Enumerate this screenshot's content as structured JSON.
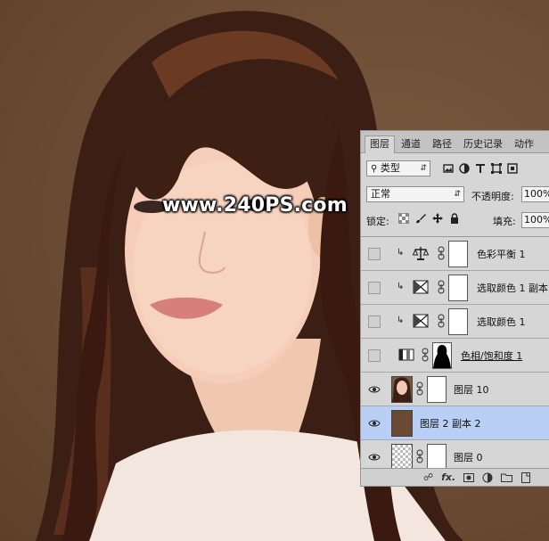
{
  "watermark": "www.240PS.com",
  "panel": {
    "tabs": [
      {
        "label": "图层",
        "active": true
      },
      {
        "label": "通道"
      },
      {
        "label": "路径"
      },
      {
        "label": "历史记录"
      },
      {
        "label": "动作"
      }
    ],
    "filter": {
      "value": "类型",
      "icon": "search-icon"
    },
    "blend_mode": "正常",
    "opacity_label": "不透明度:",
    "opacity_value": "100%",
    "lock_label": "锁定:",
    "fill_label": "填充:",
    "fill_value": "100%",
    "layers": [
      {
        "name": "色彩平衡 1",
        "type": "adjustment",
        "icon": "balance-icon",
        "clipped": true,
        "visible": false
      },
      {
        "name": "选取颜色 1 副本",
        "type": "adjustment",
        "icon": "selective-color-icon",
        "clipped": true,
        "visible": false
      },
      {
        "name": "选取颜色 1",
        "type": "adjustment",
        "icon": "selective-color-icon",
        "clipped": true,
        "visible": false
      },
      {
        "name": "色相/饱和度 1",
        "type": "adjustment",
        "icon": "hue-saturation-icon",
        "clipped": false,
        "visible": false
      },
      {
        "name": "图层 10",
        "type": "pixel",
        "visible": true
      },
      {
        "name": "图层 2 副本 2",
        "type": "fill",
        "visible": true,
        "selected": true
      },
      {
        "name": "图层 0",
        "type": "pixel",
        "visible": true
      }
    ],
    "bottom_icons": [
      "link-icon",
      "fx-icon",
      "mask-icon",
      "adjustment-icon",
      "folder-icon",
      "new-layer-icon"
    ],
    "fx_label": "fx."
  },
  "colors": {
    "background": "#6b4a34",
    "selected_layer": "#b9cff5",
    "swatch": "#6b4a34"
  }
}
